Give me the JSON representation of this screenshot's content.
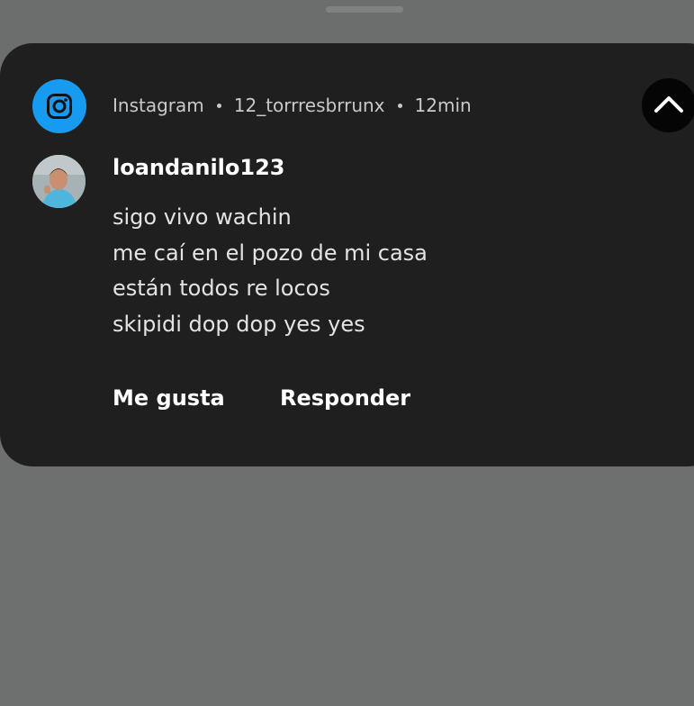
{
  "notification": {
    "app_name": "Instagram",
    "account": "12_torrresbrrunx",
    "time": "12min",
    "app_icon": "instagram-icon",
    "collapse_icon": "chevron-up-icon",
    "sender": "loandanilo123",
    "message_lines": [
      "sigo vivo wachin",
      "me caí en el pozo de mi casa",
      "están todos re locos",
      "skipidi dop dop yes yes"
    ],
    "actions": {
      "like": "Me gusta",
      "reply": "Responder"
    }
  },
  "colors": {
    "background": "#6e706f",
    "card": "#1f1f20",
    "app_accent": "#169bf0",
    "primary_text": "#ffffff",
    "secondary_text": "#c9c9c9"
  }
}
